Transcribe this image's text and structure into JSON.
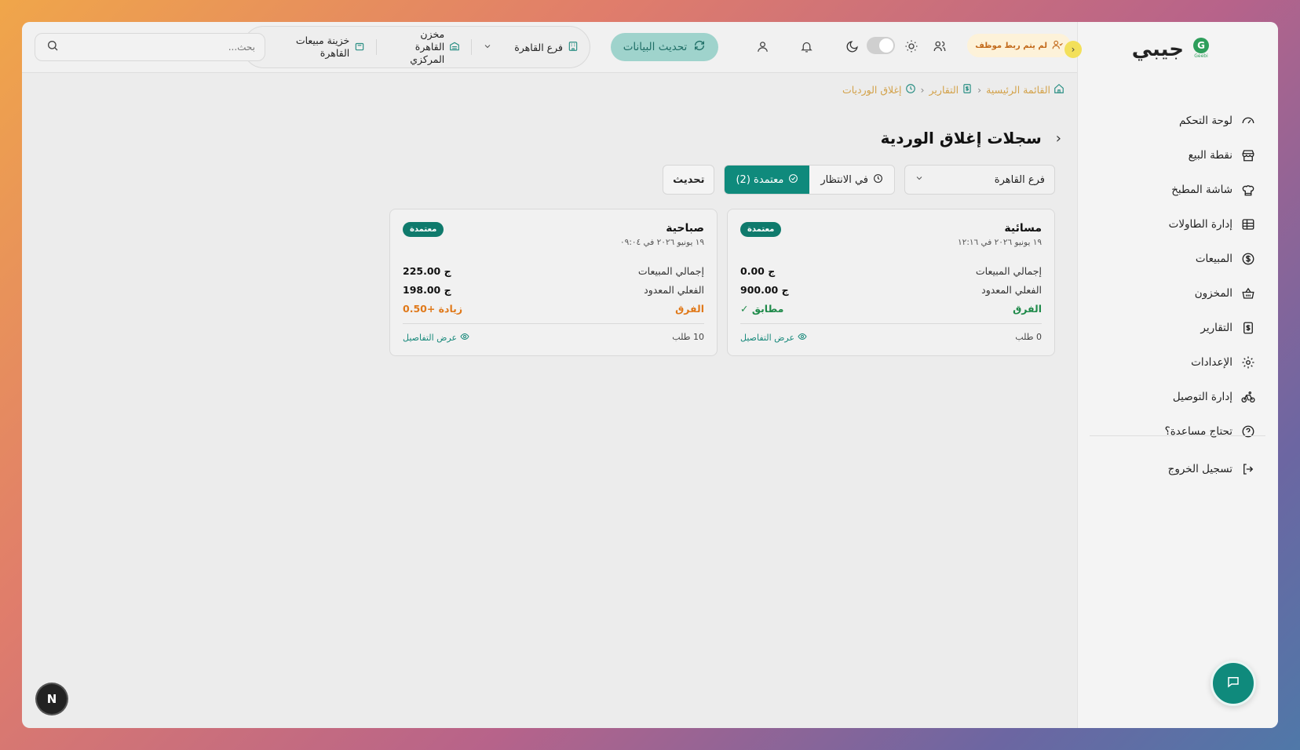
{
  "app": {
    "logo_text": "جيبي",
    "logo_sub": "Geebi",
    "logo_letter": "G"
  },
  "sidebar": {
    "items": [
      {
        "label": "لوحة التحكم",
        "icon": "gauge-icon"
      },
      {
        "label": "نقطة البيع",
        "icon": "store-icon"
      },
      {
        "label": "شاشة المطبخ",
        "icon": "chef-hat-icon"
      },
      {
        "label": "إدارة الطاولات",
        "icon": "table-icon"
      },
      {
        "label": "المبيعات",
        "icon": "dollar-circle-icon"
      },
      {
        "label": "المخزون",
        "icon": "basket-icon"
      },
      {
        "label": "التقارير",
        "icon": "report-dollar-icon"
      },
      {
        "label": "الإعدادات",
        "icon": "gear-icon"
      },
      {
        "label": "إدارة التوصيل",
        "icon": "bike-icon"
      },
      {
        "label": "تحتاج مساعدة؟",
        "icon": "help-circle-icon"
      }
    ],
    "logout_label": "تسجيل الخروج"
  },
  "topbar": {
    "warning_chip": "لم يتم ربط موظف",
    "refresh_label": "تحديث البيانات",
    "branch": "فرع القاهرة",
    "warehouse": "مخزن القاهرة المركزي",
    "treasury": "خزينة مبيعات القاهرة",
    "search_placeholder": "بحث..."
  },
  "breadcrumb": {
    "home": "القائمة الرئيسية",
    "reports": "التقارير",
    "current": "إغلاق الورديات"
  },
  "page": {
    "title": "سجلات إغلاق الوردية",
    "branch_filter": "فرع القاهرة",
    "tab_pending": "في الانتظار",
    "tab_approved": "معتمدة (2)",
    "update_label": "تحديث"
  },
  "cards": [
    {
      "title": "مسائية",
      "date": "١٩ يونيو ٢٠٢٦ في ١٢:١٦",
      "badge": "معتمدة",
      "total_sales_label": "إجمالي المبيعات",
      "total_sales": "0.00 ج",
      "counted_label": "الفعلي المعدود",
      "counted": "900.00 ج",
      "diff_label": "الفرق",
      "diff": "مطابق ✓",
      "orders": "0 طلب",
      "details": "عرض التفاصيل"
    },
    {
      "title": "صباحية",
      "date": "١٩ يونيو ٢٠٢٦ في ٠٩:٠٤",
      "badge": "معتمدة",
      "total_sales_label": "إجمالي المبيعات",
      "total_sales": "225.00 ج",
      "counted_label": "الفعلي المعدود",
      "counted": "198.00 ج",
      "diff_label": "الفرق",
      "diff": "زيادة +0.50",
      "orders": "10 طلب",
      "details": "عرض التفاصيل"
    }
  ],
  "misc": {
    "n_badge": "N"
  },
  "colors": {
    "primary": "#0f8a7c",
    "warning": "#e0791a",
    "success": "#1f8a4a",
    "breadcrumb": "#d3a24a"
  }
}
